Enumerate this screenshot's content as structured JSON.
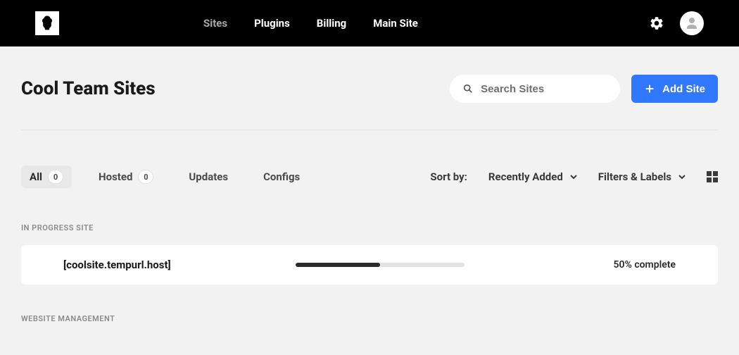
{
  "nav": {
    "items": [
      {
        "label": "Sites",
        "active": true
      },
      {
        "label": "Plugins",
        "active": false
      },
      {
        "label": "Billing",
        "active": false
      },
      {
        "label": "Main Site",
        "active": false
      }
    ]
  },
  "page": {
    "title": "Cool Team Sites"
  },
  "search": {
    "placeholder": "Search Sites"
  },
  "add_button": {
    "label": "Add Site"
  },
  "tabs": [
    {
      "label": "All",
      "count": "0",
      "selected": true,
      "has_badge": true
    },
    {
      "label": "Hosted",
      "count": "0",
      "selected": false,
      "has_badge": true
    },
    {
      "label": "Updates",
      "selected": false,
      "has_badge": false
    },
    {
      "label": "Configs",
      "selected": false,
      "has_badge": false
    }
  ],
  "sort": {
    "label": "Sort by:",
    "value": "Recently Added"
  },
  "filters": {
    "label": "Filters & Labels"
  },
  "sections": {
    "in_progress": {
      "label": "IN PROGRESS SITE",
      "site": {
        "name": "[coolsite.tempurl.host]",
        "progress_percent": 50,
        "progress_text": "50% complete"
      }
    },
    "management": {
      "label": "WEBSITE MANAGEMENT"
    }
  }
}
